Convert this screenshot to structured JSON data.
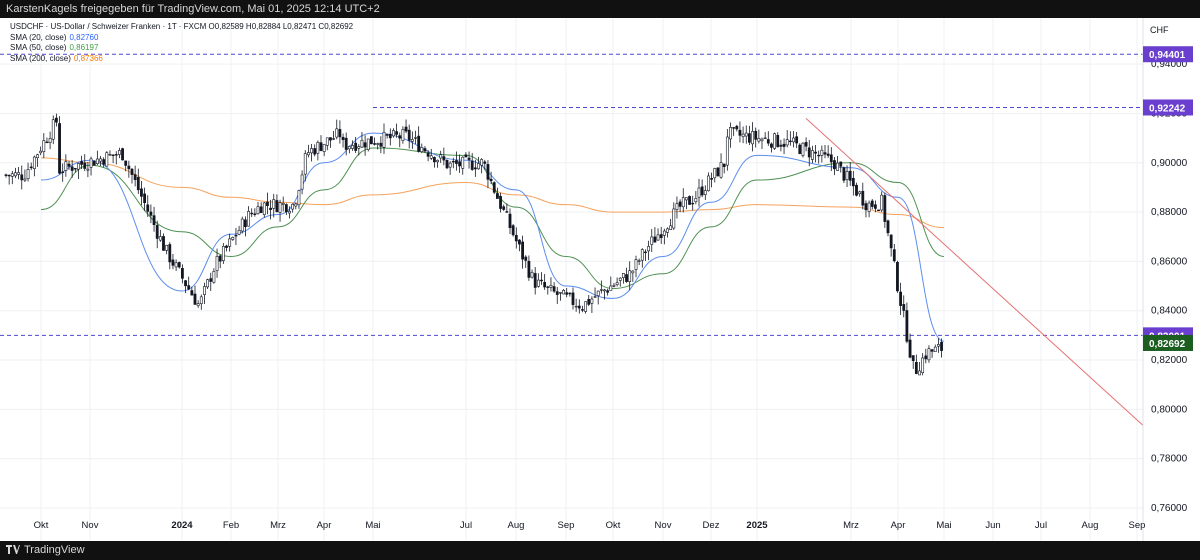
{
  "header": {
    "share_text": "KarstenKagels freigegeben für TradingView.com, Mai 01, 2025 12:14 UTC+2"
  },
  "footer": {
    "brand": "TradingView"
  },
  "currency_label": "CHF",
  "legend": {
    "symbol_line": "USDCHF · US-Dollar / Schweizer Franken · 1T · FXCM  O0,82589  H0,82884  L0,82471  C0,82692",
    "sma20": {
      "label": "SMA (20, close)",
      "value": "0,82760",
      "color": "#2962ff"
    },
    "sma50": {
      "label": "SMA (50, close)",
      "value": "0,86197",
      "color": "#43a047"
    },
    "sma200": {
      "label": "SMA (200, close)",
      "value": "0,87366",
      "color": "#f57c00"
    }
  },
  "colors": {
    "up": "#ffffff",
    "down": "#131722",
    "sma20": "#5b8def",
    "sma50": "#4e9152",
    "sma200": "#f5a25d",
    "trendline": "#e57373",
    "level_line": "#5048d0",
    "badge_level": "#6a3fd0",
    "badge_price": "#1b5e20"
  },
  "chart_data": {
    "type": "candlestick",
    "symbol": "USDCHF",
    "interval": "1T",
    "ylim": [
      0.755,
      0.948
    ],
    "y_ticks": [
      "0,76000",
      "0,78000",
      "0,80000",
      "0,82000",
      "0,84000",
      "0,86000",
      "0,88000",
      "0,90000",
      "0,92000",
      "0,94000"
    ],
    "x_ticks": [
      "Okt",
      "Nov",
      "2024",
      "Feb",
      "Mrz",
      "Apr",
      "Mai",
      "Jul",
      "Aug",
      "Sep",
      "Okt",
      "Nov",
      "Dez",
      "2025",
      "Mrz",
      "Apr",
      "Mai",
      "Jun",
      "Jul",
      "Aug",
      "Sep"
    ],
    "bold_ticks": [
      "2024",
      "2025"
    ],
    "last": {
      "open": "0,82589",
      "high": "0,82884",
      "low": "0,82471",
      "close": "0,82692"
    },
    "levels": [
      {
        "label": "0,94401",
        "value": 0.94401
      },
      {
        "label": "0,92242",
        "value": 0.92242
      },
      {
        "label": "0,83001",
        "value": 0.83001
      }
    ],
    "last_price_label": "0,82692",
    "price_path": [
      [
        "Okt",
        0.895
      ],
      [
        "Okt",
        0.918
      ],
      [
        "Nov",
        0.897
      ],
      [
        "Nov",
        0.904
      ],
      [
        "2024",
        0.865
      ],
      [
        "2024",
        0.842
      ],
      [
        "Feb",
        0.858
      ],
      [
        "Feb",
        0.878
      ],
      [
        "Mrz",
        0.883
      ],
      [
        "Mrz",
        0.883
      ],
      [
        "Apr",
        0.904
      ],
      [
        "Apr",
        0.912
      ],
      [
        "Mai",
        0.907
      ],
      [
        "Mai",
        0.911
      ],
      [
        "Jul",
        0.899
      ],
      [
        "Jul",
        0.9
      ],
      [
        "Aug",
        0.885
      ],
      [
        "Aug",
        0.852
      ],
      [
        "Sep",
        0.848
      ],
      [
        "Sep",
        0.842
      ],
      [
        "Okt",
        0.846
      ],
      [
        "Okt",
        0.855
      ],
      [
        "Nov",
        0.865
      ],
      [
        "Nov",
        0.882
      ],
      [
        "Dez",
        0.886
      ],
      [
        "Dez",
        0.901
      ],
      [
        "2025",
        0.912
      ],
      [
        "2025",
        0.908
      ],
      [
        "Mrz",
        0.9
      ],
      [
        "Mrz",
        0.883
      ],
      [
        "Apr",
        0.884
      ],
      [
        "Apr",
        0.815
      ],
      [
        "Mai",
        0.823
      ],
      [
        "Mai",
        0.8269
      ]
    ],
    "sma20": [
      [
        "Okt",
        0.893
      ],
      [
        "Nov",
        0.901
      ],
      [
        "2024",
        0.848
      ],
      [
        "Feb",
        0.871
      ],
      [
        "Mrz",
        0.879
      ],
      [
        "Apr",
        0.9
      ],
      [
        "Mai",
        0.912
      ],
      [
        "Jul",
        0.901
      ],
      [
        "Aug",
        0.889
      ],
      [
        "Sep",
        0.85
      ],
      [
        "Okt",
        0.845
      ],
      [
        "Nov",
        0.862
      ],
      [
        "Dez",
        0.884
      ],
      [
        "2025",
        0.903
      ],
      [
        "Mrz",
        0.898
      ],
      [
        "Apr",
        0.886
      ],
      [
        "Mai",
        0.8276
      ]
    ],
    "sma50": [
      [
        "Okt",
        0.881
      ],
      [
        "Nov",
        0.899
      ],
      [
        "2024",
        0.872
      ],
      [
        "Feb",
        0.862
      ],
      [
        "Mrz",
        0.874
      ],
      [
        "Apr",
        0.889
      ],
      [
        "Mai",
        0.906
      ],
      [
        "Jul",
        0.903
      ],
      [
        "Aug",
        0.882
      ],
      [
        "Sep",
        0.862
      ],
      [
        "Okt",
        0.849
      ],
      [
        "Nov",
        0.855
      ],
      [
        "Dez",
        0.874
      ],
      [
        "2025",
        0.893
      ],
      [
        "Mrz",
        0.9
      ],
      [
        "Apr",
        0.892
      ],
      [
        "Mai",
        0.862
      ]
    ],
    "sma200": [
      [
        "Okt",
        0.902
      ],
      [
        "Nov",
        0.9
      ],
      [
        "2024",
        0.89
      ],
      [
        "Feb",
        0.886
      ],
      [
        "Mrz",
        0.884
      ],
      [
        "Apr",
        0.883
      ],
      [
        "Mai",
        0.887
      ],
      [
        "Jul",
        0.892
      ],
      [
        "Aug",
        0.887
      ],
      [
        "Sep",
        0.883
      ],
      [
        "Okt",
        0.88
      ],
      [
        "Nov",
        0.88
      ],
      [
        "Dez",
        0.881
      ],
      [
        "2025",
        0.883
      ],
      [
        "Mrz",
        0.882
      ],
      [
        "Apr",
        0.879
      ],
      [
        "Mai",
        0.8737
      ]
    ],
    "trendline": {
      "start": [
        "2025",
        0.918
      ],
      "end": [
        "Sep",
        0.7935
      ]
    }
  }
}
